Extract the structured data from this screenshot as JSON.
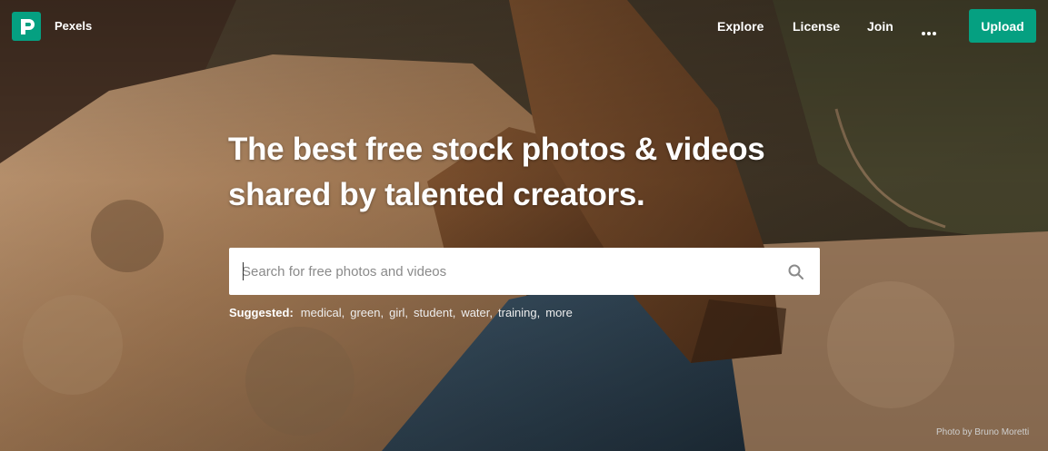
{
  "brand": {
    "name": "Pexels",
    "accent": "#05a081"
  },
  "nav": {
    "links": [
      "Explore",
      "License",
      "Join"
    ],
    "more_icon": "ellipsis-icon",
    "upload_label": "Upload"
  },
  "hero": {
    "headline_line1": "The best free stock photos & videos",
    "headline_line2": "shared by talented creators."
  },
  "search": {
    "placeholder": "Search for free photos and videos",
    "value": "",
    "icon": "search-icon"
  },
  "suggested": {
    "label": "Suggested:",
    "items": [
      "medical,",
      "green,",
      "girl,",
      "student,",
      "water,",
      "training,",
      "more"
    ]
  },
  "photo_credit": "Photo by Bruno Moretti"
}
